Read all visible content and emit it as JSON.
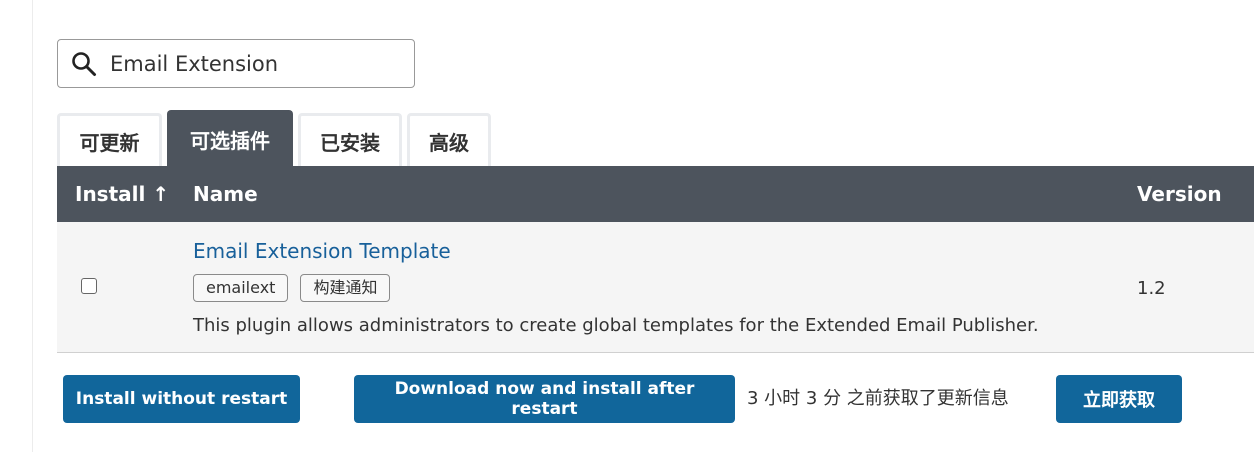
{
  "search": {
    "value": "Email Extension",
    "icon": "search-icon"
  },
  "tabs": [
    {
      "label": "可更新",
      "active": false
    },
    {
      "label": "可选插件",
      "active": true
    },
    {
      "label": "已安装",
      "active": false
    },
    {
      "label": "高级",
      "active": false
    }
  ],
  "table": {
    "headers": {
      "install": "Install ↑",
      "name": "Name",
      "version": "Version"
    },
    "rows": [
      {
        "checked": false,
        "name": "Email Extension Template",
        "labels": [
          "emailext",
          "构建通知"
        ],
        "description": "This plugin allows administrators to create global templates for the Extended Email Publisher.",
        "version": "1.2"
      }
    ]
  },
  "footer": {
    "install_button": "Install without restart",
    "download_button": "Download now and install after restart",
    "status": "3 小时 3 分 之前获取了更新信息",
    "fetch_button": "立即获取"
  },
  "colors": {
    "header_bg": "#4d545d",
    "row_bg": "#f5f5f5",
    "link": "#18609a",
    "button_bg": "#11669b"
  }
}
